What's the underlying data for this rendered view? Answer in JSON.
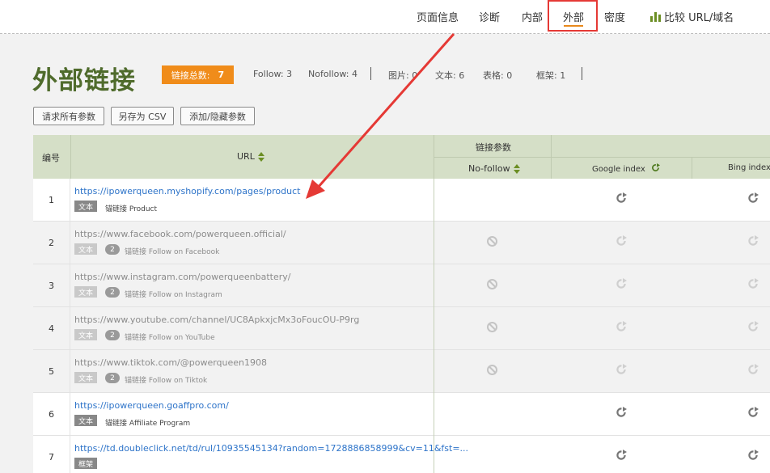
{
  "nav": {
    "items": [
      "页面信息",
      "诊断",
      "内部",
      "外部",
      "密度"
    ],
    "compare": "比较 URL/域名",
    "active_index": 3
  },
  "heading": {
    "title": "外部链接",
    "total_label": "链接总数:",
    "total_value": "7",
    "stats": [
      "Follow: 3",
      "Nofollow: 4",
      "图片: 0",
      "文本: 6",
      "表格: 0",
      "框架: 1"
    ]
  },
  "actions": [
    "请求所有参数",
    "另存为 CSV",
    "添加/隐藏参数"
  ],
  "table": {
    "headers": {
      "num": "编号",
      "url": "URL",
      "group": "链接参数",
      "nofollow": "No-follow",
      "google": "Google index",
      "bing": "Bing index"
    },
    "rows": [
      {
        "num": "1",
        "url": "https://ipowerqueen.myshopify.com/pages/product",
        "tag": "文本",
        "count": "",
        "anchor": "锚链接 Product",
        "style": "link",
        "nofollow": false
      },
      {
        "num": "2",
        "url": "https://www.facebook.com/powerqueen.official/",
        "tag": "文本",
        "count": "2",
        "anchor": "锚链接 Follow on Facebook",
        "style": "muted",
        "nofollow": true
      },
      {
        "num": "3",
        "url": "https://www.instagram.com/powerqueenbattery/",
        "tag": "文本",
        "count": "2",
        "anchor": "锚链接 Follow on Instagram",
        "style": "muted",
        "nofollow": true
      },
      {
        "num": "4",
        "url": "https://www.youtube.com/channel/UC8ApkxjcMx3oFoucOU-P9rg",
        "tag": "文本",
        "count": "2",
        "anchor": "锚链接 Follow on YouTube",
        "style": "muted",
        "nofollow": true
      },
      {
        "num": "5",
        "url": "https://www.tiktok.com/@powerqueen1908",
        "tag": "文本",
        "count": "2",
        "anchor": "锚链接 Follow on Tiktok",
        "style": "muted",
        "nofollow": true
      },
      {
        "num": "6",
        "url": "https://ipowerqueen.goaffpro.com/",
        "tag": "文本",
        "count": "",
        "anchor": "锚链接 Affiliate Program",
        "style": "link",
        "nofollow": false
      },
      {
        "num": "7",
        "url": "https://td.doubleclick.net/td/rul/10935545134?random=1728886858999&cv=11&fst=...",
        "tag": "框架",
        "count": "",
        "anchor": "",
        "style": "link",
        "nofollow": false
      }
    ]
  },
  "colors": {
    "title_green": "#4f6b2c",
    "header_bg": "#d5dfc7",
    "badge_orange": "#f08c1a",
    "link_blue": "#2e74c9",
    "annotation_red": "#e53935"
  }
}
